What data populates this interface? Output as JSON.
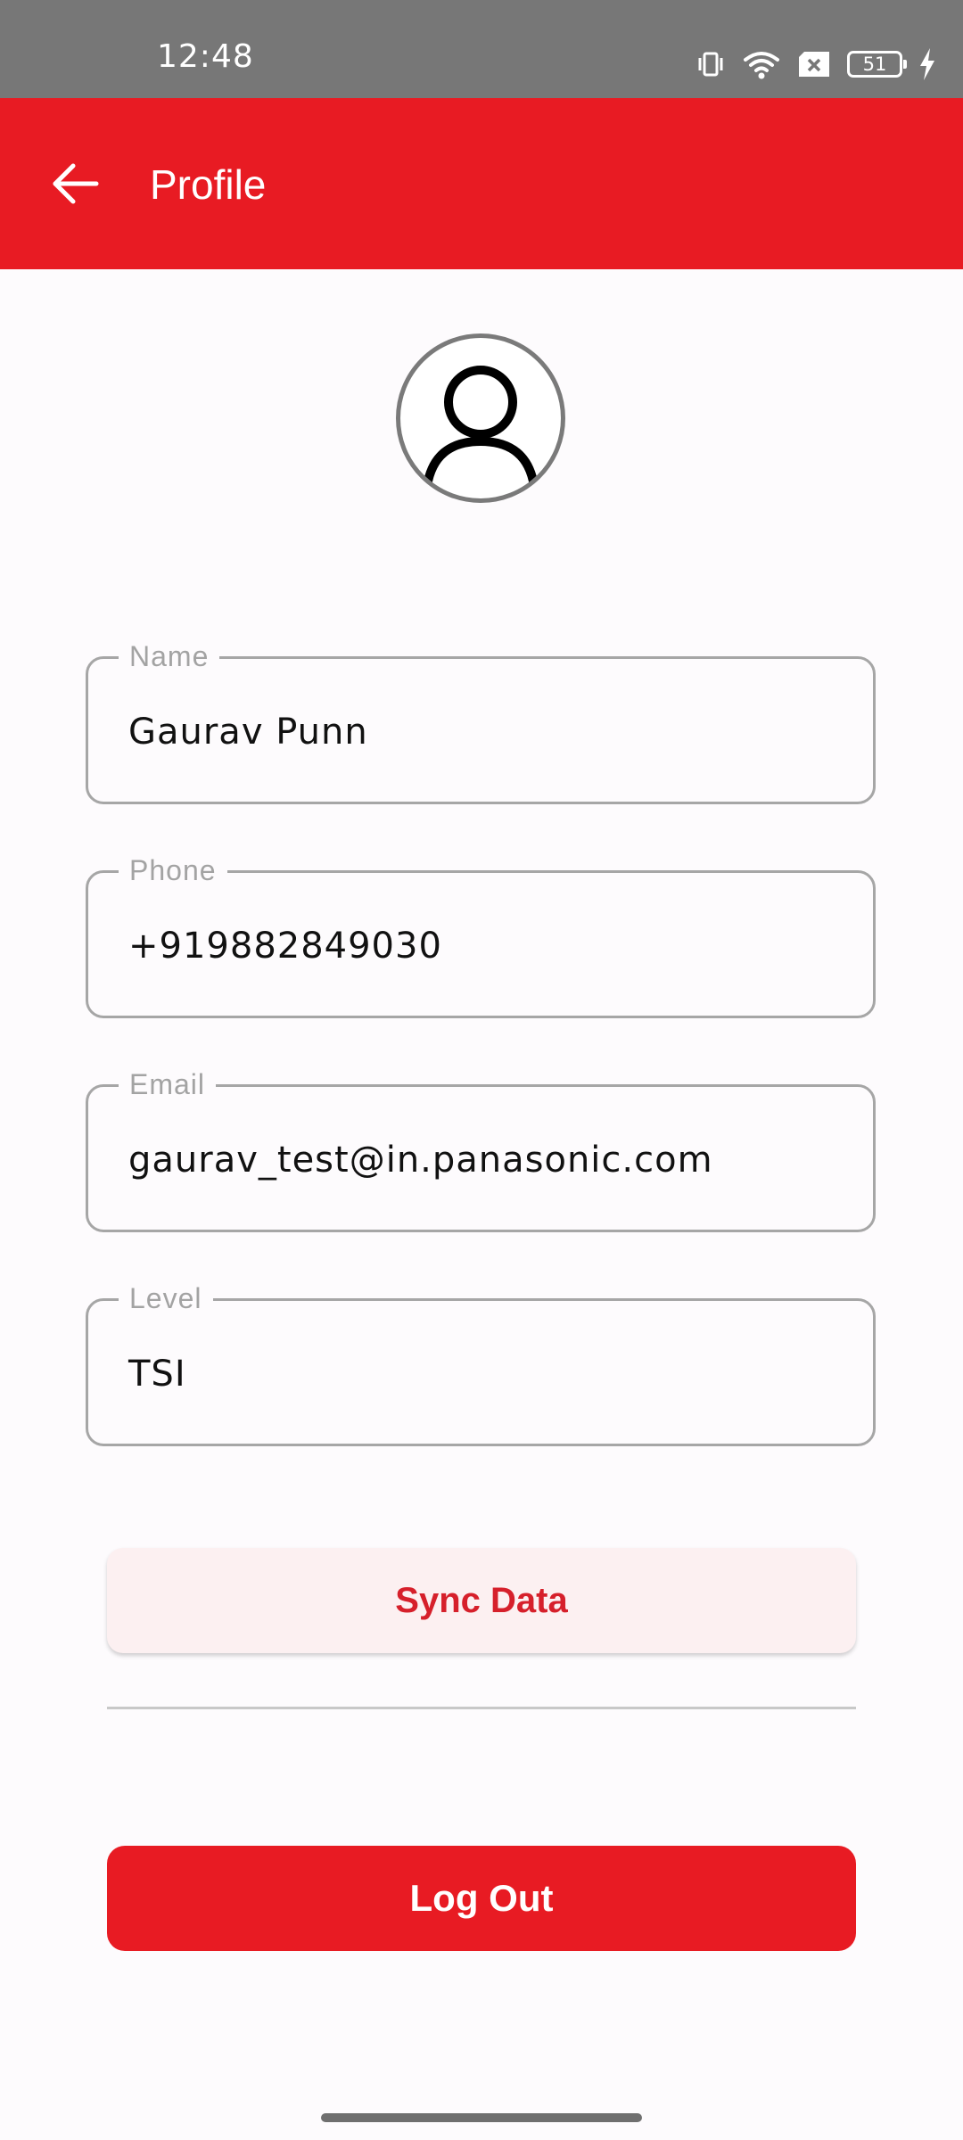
{
  "status_bar": {
    "time": "12:48",
    "battery_level": "51",
    "icons": [
      "vibrate-icon",
      "wifi-icon",
      "no-sim-icon",
      "battery-icon",
      "charging-icon"
    ]
  },
  "app_bar": {
    "title": "Profile",
    "back_icon": "arrow-left-icon",
    "color": "#e81b23"
  },
  "avatar": {
    "icon": "user-icon"
  },
  "form": {
    "fields": [
      {
        "label": "Name",
        "value": "Gaurav Punn"
      },
      {
        "label": "Phone",
        "value": "+919882849030"
      },
      {
        "label": "Email",
        "value": "gaurav_test@in.panasonic.com"
      },
      {
        "label": "Level",
        "value": "TSI"
      }
    ]
  },
  "actions": {
    "sync_label": "Sync Data",
    "logout_label": "Log Out"
  },
  "colors": {
    "accent": "#e81b23",
    "sync_background": "#fcf0f1",
    "status_bar": "#777777"
  }
}
